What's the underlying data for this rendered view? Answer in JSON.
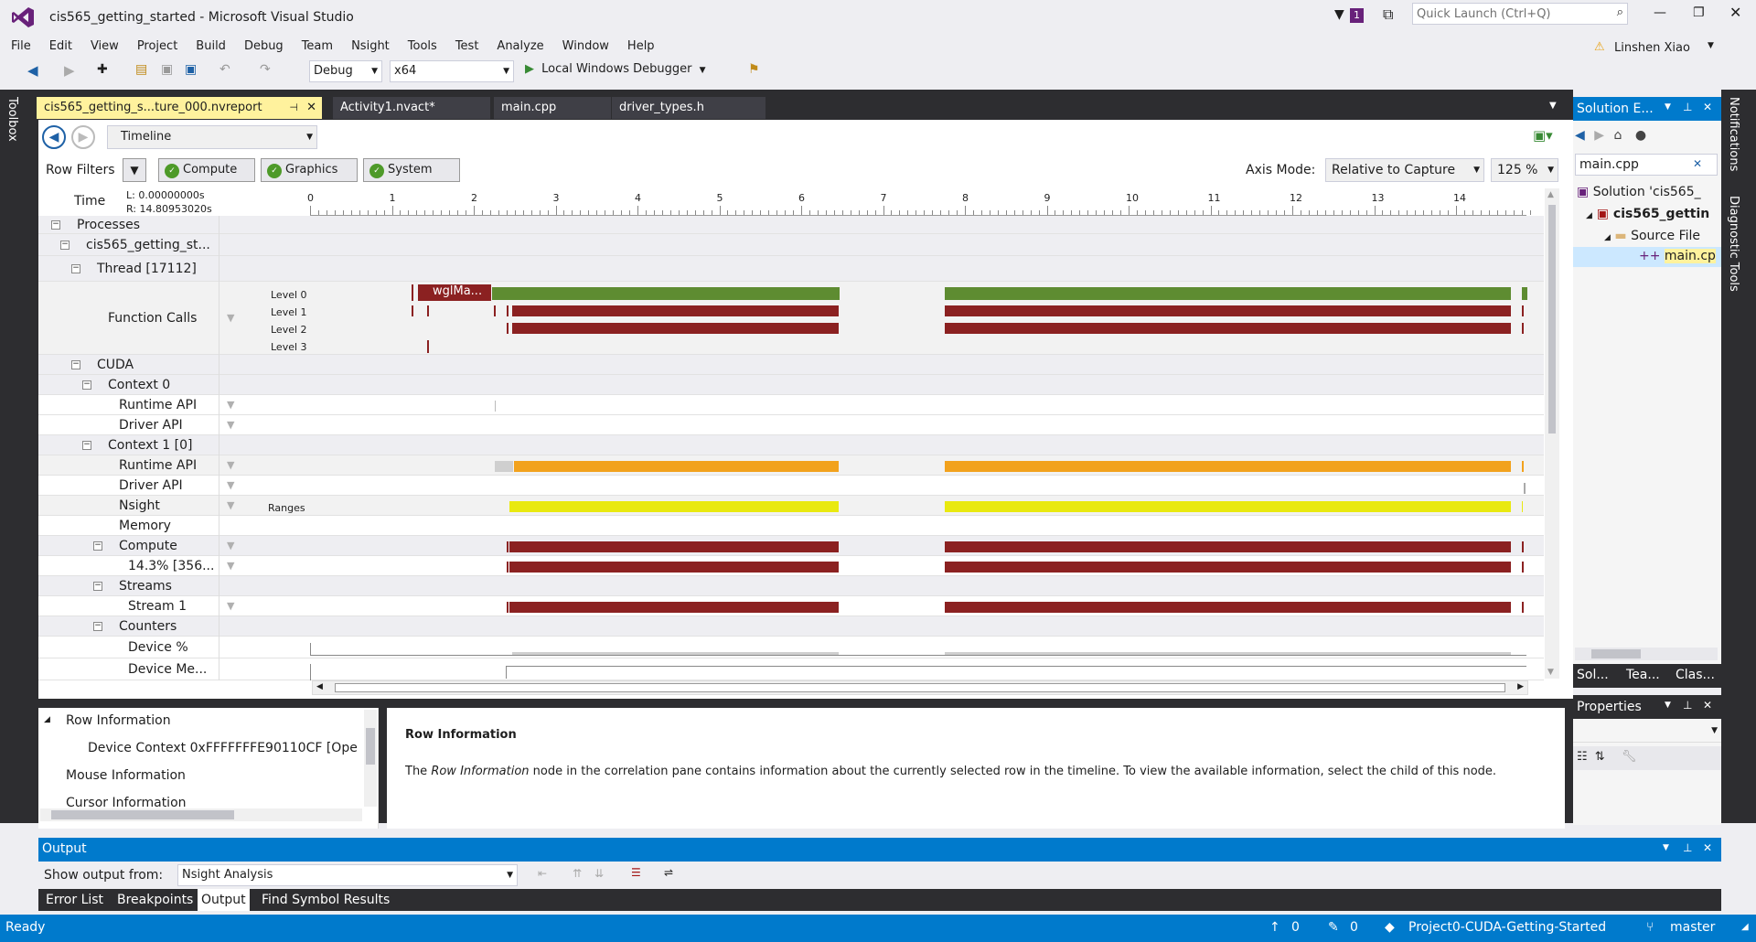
{
  "window": {
    "title": "cis565_getting_started - Microsoft Visual Studio",
    "notif_count": "1",
    "quick_launch_placeholder": "Quick Launch (Ctrl+Q)",
    "user": "Linshen Xiao"
  },
  "menu": [
    "File",
    "Edit",
    "View",
    "Project",
    "Build",
    "Debug",
    "Team",
    "Nsight",
    "Tools",
    "Test",
    "Analyze",
    "Window",
    "Help"
  ],
  "toolbar": {
    "config": "Debug",
    "platform": "x64",
    "debugger": "Local Windows Debugger"
  },
  "side_left": {
    "toolbox": "Toolbox"
  },
  "side_right": {
    "notifications": "Notifications",
    "diag": "Diagnostic Tools"
  },
  "tabs": [
    {
      "label": "cis565_getting_s...ture_000.nvreport",
      "active": true
    },
    {
      "label": "Activity1.nvact*"
    },
    {
      "label": "main.cpp"
    },
    {
      "label": "driver_types.h"
    }
  ],
  "report": {
    "view": "Timeline",
    "row_filters": "Row Filters",
    "filter_buttons": [
      "Compute",
      "Graphics",
      "System"
    ],
    "axis_mode_label": "Axis Mode:",
    "axis_mode": "Relative to Capture",
    "zoom": "125 %",
    "time_label": "Time",
    "time_l": "L: 0.00000000s",
    "time_r": "R: 14.80953020s",
    "ticks": [
      "0",
      "1",
      "2",
      "3",
      "4",
      "5",
      "6",
      "7",
      "8",
      "9",
      "10",
      "11",
      "12",
      "13",
      "14"
    ],
    "rows": {
      "processes": "Processes",
      "process": "cis565_getting_st...",
      "thread": "Thread [17112]",
      "function_calls": "Function Calls",
      "levels": [
        "Level 0",
        "Level 1",
        "Level 2",
        "Level 3"
      ],
      "call_label": "wglMa...",
      "cuda": "CUDA",
      "ctx0": "Context 0",
      "runtime_api": "Runtime API",
      "driver_api": "Driver API",
      "ctx1": "Context 1 [0]",
      "nsight": "Nsight",
      "ranges": "Ranges",
      "memory": "Memory",
      "compute": "Compute",
      "compute_pct": "14.3% [356...",
      "streams": "Streams",
      "stream1": "Stream 1",
      "counters": "Counters",
      "device_pct": "Device %",
      "device_mem": "Device Me..."
    }
  },
  "correlation": {
    "tree": [
      "Row Information",
      "Device Context 0xFFFFFFFE90110CF [Ope",
      "Mouse Information",
      "Cursor Information"
    ],
    "heading": "Row Information",
    "body_prefix": "The ",
    "body_em": "Row Information",
    "body_suffix": " node in the correlation pane contains information about the currently selected row in the timeline. To view the available information, select the child of this node."
  },
  "solution_explorer": {
    "title": "Solution E...",
    "search": "main.cpp",
    "items": [
      "Solution 'cis565_",
      "cis565_gettin",
      "Source File",
      "main.cp"
    ],
    "tabs": [
      "Sol...",
      "Tea...",
      "Clas..."
    ]
  },
  "properties": {
    "title": "Properties"
  },
  "output": {
    "title": "Output",
    "show_from_label": "Show output from:",
    "source": "Nsight Analysis",
    "tabs": [
      "Error List",
      "Breakpoints",
      "Output",
      "Find Symbol Results"
    ]
  },
  "status": {
    "ready": "Ready",
    "up": "0",
    "pencil": "0",
    "repo": "Project0-CUDA-Getting-Started",
    "branch": "master"
  }
}
